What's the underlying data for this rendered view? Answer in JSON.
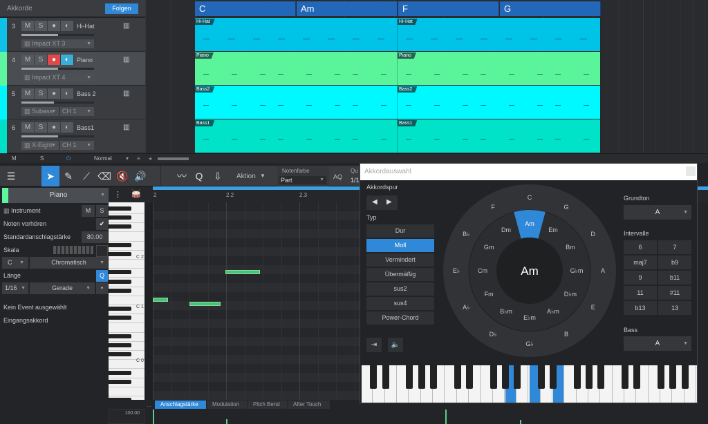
{
  "arranger": {
    "chord_track_label": "Akkorde",
    "follow_button": "Folgen",
    "chords": [
      {
        "name": "C"
      },
      {
        "name": "Am"
      },
      {
        "name": "F"
      },
      {
        "name": "G"
      }
    ],
    "tracks": [
      {
        "number": "3",
        "name": "Hi-Hat",
        "instrument": "Impact XT 3",
        "channel": "",
        "color": "#0fc0e8",
        "selected": false,
        "record_on": false,
        "monitor_on": false,
        "volume": 0.5
      },
      {
        "number": "4",
        "name": "Piano",
        "instrument": "Impact XT 4",
        "channel": "",
        "color": "#5ef5a0",
        "selected": true,
        "record_on": true,
        "monitor_on": true,
        "volume": 0.5
      },
      {
        "number": "5",
        "name": "Bass 2",
        "instrument": "Subass",
        "channel": "CH 1",
        "color": "#00f5ff",
        "selected": false,
        "record_on": false,
        "monitor_on": false,
        "volume": 0.45
      },
      {
        "number": "6",
        "name": "Bass1",
        "instrument": "X-Eight",
        "channel": "CH 1",
        "color": "#00e0c8",
        "selected": false,
        "record_on": false,
        "monitor_on": false,
        "volume": 0.5
      }
    ],
    "lanes": [
      {
        "label": "Hi-Hat",
        "color": "#00c3e8"
      },
      {
        "label": "Piano",
        "color": "#5af59a"
      },
      {
        "label": "Bass2",
        "color": "#00f8ff"
      },
      {
        "label": "Bass1",
        "color": "#00e3c8"
      }
    ],
    "track_button_labels": {
      "mute": "M",
      "solo": "S"
    },
    "footer": {
      "mute": "M",
      "solo": "S",
      "mode": "Normal"
    }
  },
  "toolbar": {
    "action_label": "Aktion",
    "note_color_label": "Notenfarbe",
    "note_color_value": "Part",
    "aq_label": "AQ",
    "quantize_label": "Qu",
    "quantize_value": "1/1"
  },
  "inspector": {
    "track_name": "Piano",
    "instrument_label": "Instrument",
    "m_label": "M",
    "s_label": "S",
    "preview_label": "Noten vorhören",
    "preview_checked": true,
    "velocity_label": "Standardanschlagstärke",
    "velocity_value": "80.00",
    "scale_label": "Skala",
    "scale_root": "C",
    "scale_type": "Chromatisch",
    "length_label": "Länge",
    "length_value": "1/16",
    "length_mode": "Gerade",
    "q_label": "Q",
    "no_event_label": "Kein Event ausgewählt",
    "input_chord_label": "Eingangsakkord"
  },
  "piano_roll": {
    "ruler_labels": [
      "2",
      "2.2",
      "2.3"
    ],
    "key_labels": [
      "C 2",
      "C 1",
      "C 0"
    ],
    "tabs": [
      "Anschlagstärke",
      "Modulation",
      "Pitch Bend",
      "After Touch"
    ],
    "active_tab": "Anschlagstärke",
    "tab_more": "...",
    "velocity_scale_max": "100.00"
  },
  "chord_dialog": {
    "title": "Akkordauswahl",
    "chord_track_label": "Akkordspur",
    "type_label": "Typ",
    "types": [
      "Dur",
      "Moll",
      "Vermindert",
      "Übermäßig",
      "sus2",
      "sus4",
      "Power-Chord"
    ],
    "selected_type": "Moll",
    "root_label": "Grundton",
    "root_value": "A",
    "intervals_label": "Intervalle",
    "intervals": [
      "6",
      "7",
      "maj7",
      "b9",
      "9",
      "b11",
      "11",
      "#11",
      "b13",
      "13"
    ],
    "bass_label": "Bass",
    "bass_value": "A",
    "current_chord": "Am",
    "outer_ring": [
      "C",
      "G",
      "D",
      "A",
      "E",
      "B",
      "G♭",
      "D♭",
      "A♭",
      "E♭",
      "B♭",
      "F"
    ],
    "inner_ring": [
      "Am",
      "Em",
      "Bm",
      "G♭m",
      "D♭m",
      "A♭m",
      "E♭m",
      "B♭m",
      "Fm",
      "Cm",
      "Gm",
      "Dm"
    ],
    "highlighted": "Am",
    "accent_color": "#2f88d8"
  }
}
